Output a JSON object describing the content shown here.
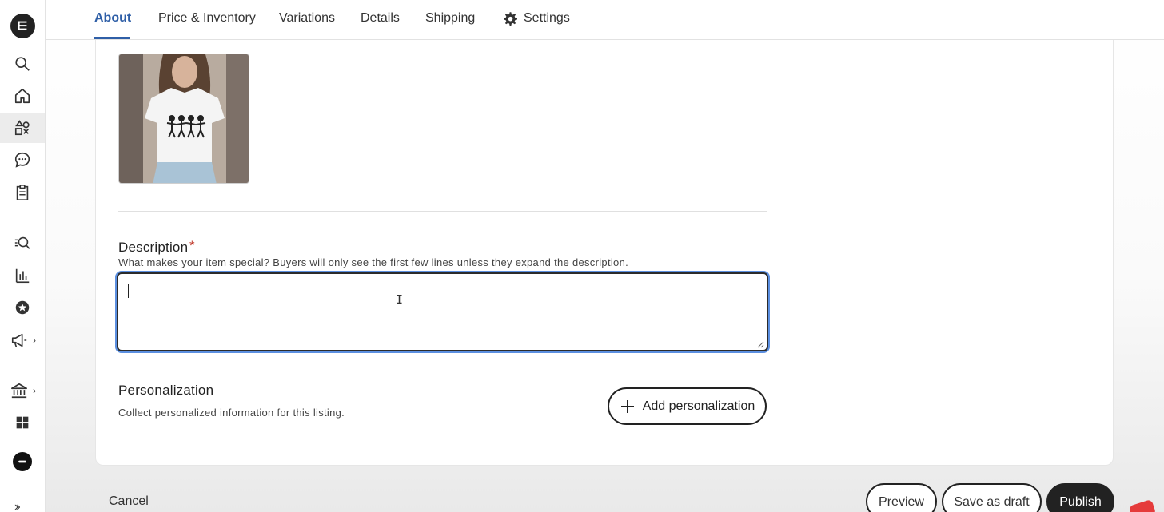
{
  "tabs": [
    {
      "label": "About",
      "active": true
    },
    {
      "label": "Price & Inventory",
      "active": false
    },
    {
      "label": "Variations",
      "active": false
    },
    {
      "label": "Details",
      "active": false
    },
    {
      "label": "Shipping",
      "active": false
    },
    {
      "label": "Settings",
      "active": false,
      "icon": "gear-icon"
    }
  ],
  "sidebar": {
    "items": [
      {
        "icon": "etsy-logo-icon"
      },
      {
        "icon": "search-icon"
      },
      {
        "icon": "home-icon"
      },
      {
        "icon": "listings-shapes-icon",
        "active": true
      },
      {
        "icon": "messages-icon"
      },
      {
        "icon": "orders-clipboard-icon"
      },
      {
        "icon": "stats-search-icon"
      },
      {
        "icon": "bar-chart-icon"
      },
      {
        "icon": "star-badge-icon"
      },
      {
        "icon": "megaphone-icon",
        "has_submenu": true
      },
      {
        "icon": "bank-icon",
        "has_submenu": true
      },
      {
        "icon": "grid-icon"
      },
      {
        "icon": "shop-avatar-icon"
      },
      {
        "icon": "expand-icon"
      }
    ]
  },
  "listing": {
    "photo_icon": "product-photo-tshirt",
    "description": {
      "label": "Description",
      "required_mark": "*",
      "help": "What makes your item special? Buyers will only see the first few lines unless they expand the description.",
      "value": ""
    },
    "personalization": {
      "title": "Personalization",
      "help": "Collect personalized information for this listing.",
      "button_label": "Add personalization"
    }
  },
  "actions": {
    "cancel": "Cancel",
    "preview": "Preview",
    "save_draft": "Save as draft",
    "publish": "Publish"
  },
  "colors": {
    "accent": "#2f5fa7",
    "focus_ring": "#5b8fe0",
    "required": "#c0392b",
    "primary_button": "#222222"
  }
}
